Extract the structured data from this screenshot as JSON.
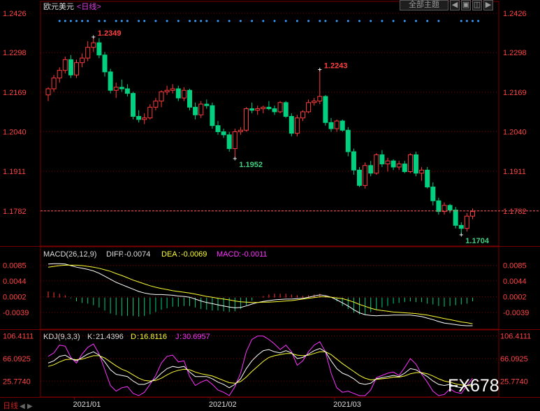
{
  "header": {
    "title": "欧元美元",
    "period": "<日线>",
    "main_indicator_button": "全部主题",
    "left_arrow": "◀",
    "right_arrow": "▶",
    "expand_symbol": "◫",
    "palette_symbol": "▣"
  },
  "watermark": "FX678",
  "bottom_tab": {
    "label": "日线",
    "prev": "◀",
    "next": "▶"
  },
  "colors": {
    "up": "#ff3b3b",
    "down": "#00d080",
    "grid": "#7a0000",
    "dif": "#ffffff",
    "dea": "#ffff33",
    "macd": "#ff33ff",
    "k": "#ffffff",
    "d": "#ffff33",
    "j": "#ff33ff",
    "marker": "#3aa0ff",
    "last_price": "#ff6060",
    "axis_text": "#ff4444"
  },
  "chart_data": [
    {
      "type": "candlestick",
      "title": "欧元美元",
      "period": "日线",
      "yticks": [
        "1.2426",
        "1.2298",
        "1.2169",
        "1.2040",
        "1.1911",
        "1.1782"
      ],
      "ylim": [
        1.1704,
        1.2426
      ],
      "last_price": "1.1782",
      "xticks": [
        "2021/01",
        "2021/02",
        "2021/03"
      ],
      "annotations": [
        {
          "text": "1.2349",
          "kind": "high"
        },
        {
          "text": "1.2243",
          "kind": "high"
        },
        {
          "text": "1.1952",
          "kind": "low"
        },
        {
          "text": "1.1704",
          "kind": "low"
        }
      ],
      "candles": [
        [
          1.216,
          1.2185,
          1.214,
          1.218
        ],
        [
          1.218,
          1.2225,
          1.217,
          1.2215
        ],
        [
          1.2215,
          1.225,
          1.22,
          1.224
        ],
        [
          1.224,
          1.2285,
          1.223,
          1.2275
        ],
        [
          1.2275,
          1.229,
          1.2215,
          1.2225
        ],
        [
          1.2225,
          1.2275,
          1.2215,
          1.2265
        ],
        [
          1.2265,
          1.2295,
          1.225,
          1.228
        ],
        [
          1.228,
          1.2335,
          1.227,
          1.2315
        ],
        [
          1.2315,
          1.2349,
          1.23,
          1.233
        ],
        [
          1.233,
          1.2345,
          1.228,
          1.229
        ],
        [
          1.229,
          1.23,
          1.222,
          1.2235
        ],
        [
          1.2235,
          1.2245,
          1.2165,
          1.2175
        ],
        [
          1.2175,
          1.22,
          1.215,
          1.2185
        ],
        [
          1.2185,
          1.221,
          1.217,
          1.218
        ],
        [
          1.218,
          1.2195,
          1.2155,
          1.2165
        ],
        [
          1.2165,
          1.217,
          1.208,
          1.209
        ],
        [
          1.209,
          1.211,
          1.207,
          1.208
        ],
        [
          1.208,
          1.21,
          1.2065,
          1.2085
        ],
        [
          1.2085,
          1.213,
          1.208,
          1.212
        ],
        [
          1.212,
          1.215,
          1.211,
          1.214
        ],
        [
          1.214,
          1.2175,
          1.212,
          1.217
        ],
        [
          1.217,
          1.219,
          1.216,
          1.2175
        ],
        [
          1.2175,
          1.2195,
          1.2165,
          1.218
        ],
        [
          1.218,
          1.219,
          1.214,
          1.215
        ],
        [
          1.215,
          1.2185,
          1.214,
          1.2175
        ],
        [
          1.2175,
          1.218,
          1.211,
          1.212
        ],
        [
          1.212,
          1.2135,
          1.208,
          1.2095
        ],
        [
          1.2095,
          1.214,
          1.2085,
          1.213
        ],
        [
          1.213,
          1.2145,
          1.2115,
          1.2125
        ],
        [
          1.2125,
          1.2135,
          1.205,
          1.206
        ],
        [
          1.206,
          1.2075,
          1.203,
          1.204
        ],
        [
          1.204,
          1.205,
          1.202,
          1.203
        ],
        [
          1.203,
          1.204,
          1.1975,
          1.1985
        ],
        [
          1.1985,
          1.205,
          1.1952,
          1.204
        ],
        [
          1.204,
          1.2055,
          1.203,
          1.2045
        ],
        [
          1.2045,
          1.212,
          1.204,
          1.2115
        ],
        [
          1.2115,
          1.2135,
          1.21,
          1.211
        ],
        [
          1.211,
          1.2125,
          1.2095,
          1.2115
        ],
        [
          1.2115,
          1.2125,
          1.21,
          1.212
        ],
        [
          1.212,
          1.214,
          1.211,
          1.2115
        ],
        [
          1.2115,
          1.2125,
          1.2095,
          1.2105
        ],
        [
          1.2105,
          1.214,
          1.21,
          1.2135
        ],
        [
          1.2135,
          1.214,
          1.2085,
          1.209
        ],
        [
          1.209,
          1.21,
          1.2025,
          1.2035
        ],
        [
          1.2035,
          1.2095,
          1.2025,
          1.2085
        ],
        [
          1.2085,
          1.211,
          1.2075,
          1.2105
        ],
        [
          1.2105,
          1.2145,
          1.21,
          1.2135
        ],
        [
          1.2135,
          1.215,
          1.2125,
          1.214
        ],
        [
          1.214,
          1.2243,
          1.213,
          1.2155
        ],
        [
          1.2155,
          1.216,
          1.206,
          1.207
        ],
        [
          1.207,
          1.2085,
          1.204,
          1.205
        ],
        [
          1.205,
          1.208,
          1.204,
          1.2075
        ],
        [
          1.2075,
          1.208,
          1.204,
          1.2045
        ],
        [
          1.2045,
          1.2055,
          1.196,
          1.1975
        ],
        [
          1.1975,
          1.1985,
          1.19,
          1.1915
        ],
        [
          1.1915,
          1.1925,
          1.186,
          1.1865
        ],
        [
          1.1865,
          1.194,
          1.1855,
          1.193
        ],
        [
          1.193,
          1.1945,
          1.1895,
          1.1905
        ],
        [
          1.1905,
          1.197,
          1.19,
          1.1965
        ],
        [
          1.1965,
          1.198,
          1.1925,
          1.1935
        ],
        [
          1.1935,
          1.1955,
          1.191,
          1.1945
        ],
        [
          1.1945,
          1.195,
          1.1915,
          1.1925
        ],
        [
          1.1925,
          1.1945,
          1.1915,
          1.1935
        ],
        [
          1.1935,
          1.1945,
          1.1905,
          1.191
        ],
        [
          1.191,
          1.197,
          1.1905,
          1.1965
        ],
        [
          1.1965,
          1.1975,
          1.1895,
          1.1905
        ],
        [
          1.1905,
          1.1925,
          1.188,
          1.1915
        ],
        [
          1.1915,
          1.1925,
          1.1855,
          1.186
        ],
        [
          1.186,
          1.1875,
          1.18,
          1.1815
        ],
        [
          1.1815,
          1.1825,
          1.177,
          1.178
        ],
        [
          1.178,
          1.181,
          1.177,
          1.18
        ],
        [
          1.18,
          1.1805,
          1.1775,
          1.1785
        ],
        [
          1.1785,
          1.1795,
          1.1725,
          1.1735
        ],
        [
          1.1735,
          1.1745,
          1.1704,
          1.1725
        ],
        [
          1.1725,
          1.1775,
          1.1715,
          1.1765
        ],
        [
          1.1765,
          1.179,
          1.1755,
          1.178
        ]
      ]
    },
    {
      "type": "line",
      "title": "MACD(26,12,9)",
      "legend": [
        {
          "name": "DIFF",
          "value": "-0.0074"
        },
        {
          "name": "DEA",
          "value": "-0.0069"
        },
        {
          "name": "MACD",
          "value": "-0.0011"
        }
      ],
      "yticks": [
        "0.0085",
        "0.0044",
        "0.0002",
        "-0.0039"
      ],
      "ylim": [
        -0.0074,
        0.0095
      ],
      "dif": [
        0.0088,
        0.0089,
        0.0089,
        0.0088,
        0.0084,
        0.008,
        0.0077,
        0.0074,
        0.007,
        0.0064,
        0.0056,
        0.0048,
        0.004,
        0.0034,
        0.0028,
        0.0022,
        0.0016,
        0.0012,
        0.0009,
        0.0008,
        0.0008,
        0.0007,
        0.0006,
        0.0004,
        0.0003,
        0.0001,
        -0.0004,
        -0.0009,
        -0.0013,
        -0.0016,
        -0.0019,
        -0.0022,
        -0.0025,
        -0.0027,
        -0.0026,
        -0.0022,
        -0.0017,
        -0.0013,
        -0.001,
        -0.0008,
        -0.0006,
        -0.0005,
        -0.0004,
        -0.0004,
        -0.0003,
        -0.0002,
        0.0001,
        0.0004,
        0.0007,
        0.0005,
        0.0001,
        -0.0006,
        -0.0014,
        -0.0022,
        -0.0032,
        -0.004,
        -0.0045,
        -0.0047,
        -0.0048,
        -0.0047,
        -0.0047,
        -0.0046,
        -0.0046,
        -0.0046,
        -0.0046,
        -0.0048,
        -0.005,
        -0.0054,
        -0.0058,
        -0.0063,
        -0.0067,
        -0.0069,
        -0.0071,
        -0.0073,
        -0.0074,
        -0.0074
      ],
      "dea": [
        0.008,
        0.0082,
        0.0084,
        0.0085,
        0.0085,
        0.0085,
        0.0084,
        0.0082,
        0.008,
        0.0077,
        0.0073,
        0.0069,
        0.0063,
        0.0058,
        0.0052,
        0.0046,
        0.0041,
        0.0036,
        0.0031,
        0.0027,
        0.0024,
        0.0021,
        0.0018,
        0.0016,
        0.0014,
        0.0012,
        0.0009,
        0.0006,
        0.0003,
        0.0001,
        -0.0002,
        -0.0004,
        -0.0006,
        -0.0009,
        -0.0011,
        -0.0012,
        -0.0013,
        -0.0013,
        -0.0012,
        -0.0012,
        -0.0011,
        -0.001,
        -0.0009,
        -0.0008,
        -0.0006,
        -0.0004,
        -0.0002,
        0.0,
        0.0002,
        0.0002,
        0.0001,
        -0.0001,
        -0.0003,
        -0.0007,
        -0.0012,
        -0.0018,
        -0.0023,
        -0.0028,
        -0.0032,
        -0.0034,
        -0.0036,
        -0.0038,
        -0.0039,
        -0.004,
        -0.0041,
        -0.0042,
        -0.0044,
        -0.0046,
        -0.0049,
        -0.0052,
        -0.0055,
        -0.0058,
        -0.0061,
        -0.0064,
        -0.0066,
        -0.0069
      ]
    },
    {
      "type": "line",
      "title": "KDJ(9,3,3)",
      "legend": [
        {
          "name": "K",
          "value": "21.4396"
        },
        {
          "name": "D",
          "value": "16.8116"
        },
        {
          "name": "J",
          "value": "30.6957"
        }
      ],
      "yticks": [
        "106.4111",
        "66.0925",
        "25.7740"
      ],
      "ylim": [
        0,
        112
      ],
      "k": [
        58,
        62,
        70,
        72,
        66,
        62,
        68,
        74,
        78,
        72,
        60,
        46,
        38,
        36,
        34,
        26,
        20,
        20,
        24,
        30,
        40,
        48,
        52,
        50,
        52,
        42,
        34,
        34,
        34,
        30,
        24,
        20,
        14,
        20,
        30,
        48,
        62,
        72,
        80,
        82,
        78,
        76,
        80,
        76,
        66,
        68,
        74,
        80,
        84,
        78,
        62,
        48,
        40,
        36,
        30,
        22,
        20,
        22,
        30,
        32,
        34,
        36,
        34,
        40,
        48,
        46,
        40,
        34,
        26,
        20,
        18,
        20,
        16,
        14,
        18,
        21
      ],
      "d": [
        52,
        55,
        60,
        64,
        65,
        64,
        65,
        68,
        71,
        71,
        67,
        60,
        53,
        47,
        43,
        37,
        31,
        27,
        26,
        27,
        31,
        37,
        42,
        45,
        47,
        46,
        42,
        39,
        37,
        35,
        31,
        27,
        23,
        22,
        25,
        33,
        43,
        52,
        61,
        68,
        71,
        73,
        75,
        75,
        72,
        71,
        72,
        75,
        78,
        78,
        73,
        65,
        57,
        50,
        43,
        36,
        31,
        28,
        29,
        30,
        31,
        33,
        33,
        35,
        39,
        41,
        41,
        39,
        35,
        30,
        26,
        24,
        21,
        19,
        18,
        17
      ],
      "j": [
        70,
        76,
        90,
        88,
        68,
        58,
        74,
        86,
        92,
        74,
        46,
        18,
        8,
        14,
        16,
        4,
        0,
        6,
        20,
        36,
        58,
        70,
        72,
        60,
        62,
        34,
        18,
        24,
        28,
        20,
        10,
        6,
        0,
        16,
        40,
        78,
        100,
        106,
        106,
        100,
        92,
        82,
        90,
        78,
        54,
        62,
        78,
        90,
        96,
        78,
        40,
        14,
        6,
        8,
        4,
        0,
        0,
        10,
        32,
        36,
        40,
        42,
        36,
        50,
        66,
        56,
        38,
        24,
        8,
        0,
        2,
        12,
        6,
        4,
        18,
        31
      ]
    }
  ]
}
